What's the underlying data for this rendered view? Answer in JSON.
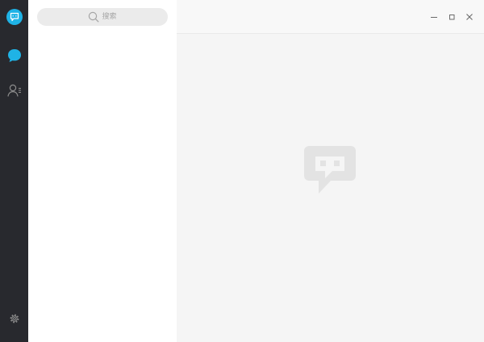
{
  "search": {
    "placeholder": "搜索"
  },
  "colors": {
    "rail_bg": "#28292e",
    "accent": "#1fb3e6",
    "list_bg": "#ffffff",
    "main_bg": "#f5f5f5",
    "icon_muted": "#8c8c8c",
    "watermark": "#e3e3e3"
  },
  "icons": {
    "app": "chat-bubble-logo-icon",
    "messages": "chat-bubble-icon",
    "contacts": "contacts-icon",
    "settings": "gear-icon",
    "search": "search-icon",
    "minimize": "minimize-icon",
    "maximize": "maximize-icon",
    "close": "close-icon",
    "empty_state": "chat-bubble-watermark-icon"
  }
}
